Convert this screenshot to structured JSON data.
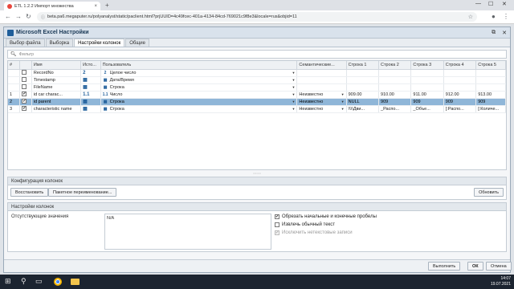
{
  "browser": {
    "tab_title": "ETL 1.2.2 Импорт множества",
    "close_glyph": "×",
    "new_tab": "+",
    "url": "beta.pa6.megaputer.ru/polyanalyst/static/paclient.html?prjUUID=4c49fcec-401a-4134-84cd-769021c9f8e3&locale=rus&objid=11"
  },
  "window": {
    "title": "Microsoft Excel Настройки"
  },
  "tabs": [
    "Выбор файла",
    "Выборка",
    "Настройки колонок",
    "Общие"
  ],
  "active_tab": 2,
  "filter": {
    "placeholder": "Фильтр"
  },
  "grid": {
    "headers": [
      "#",
      "",
      "Имя",
      "Исто...",
      "Пользователь",
      "Семантические...",
      "Строка 1",
      "Строка 2",
      "Строка 3",
      "Строка 4",
      "Строка 5"
    ],
    "rows": [
      {
        "num": "",
        "checked": false,
        "name": "RecordNo",
        "src": "2",
        "type_icon": "2",
        "type": "Целое число",
        "sem": "",
        "s1": "",
        "s2": "",
        "s3": "",
        "s4": "",
        "s5": ""
      },
      {
        "num": "",
        "checked": false,
        "name": "Timestamp",
        "src": "▦",
        "type_icon": "▦",
        "type": "Дата/Время",
        "sem": "",
        "s1": "",
        "s2": "",
        "s3": "",
        "s4": "",
        "s5": ""
      },
      {
        "num": "",
        "checked": false,
        "name": "FileName",
        "src": "▦",
        "type_icon": "▦",
        "type": "Строка",
        "sem": "",
        "s1": "",
        "s2": "",
        "s3": "",
        "s4": "",
        "s5": ""
      },
      {
        "num": "1",
        "checked": true,
        "name": "id car charac...",
        "src": "1.1",
        "type_icon": "1.1",
        "type": "Число",
        "sem": "Неизвестно",
        "s1": "909.00",
        "s2": "910.00",
        "s3": "911.00",
        "s4": "912.00",
        "s5": "913.00"
      },
      {
        "num": "2",
        "checked": true,
        "name": "id parent",
        "src": "▦",
        "type_icon": "▦",
        "type": "Строка",
        "sem": "Неизвестно",
        "s1": "NULL",
        "s2": "909",
        "s3": "909",
        "s4": "909",
        "s5": "909"
      },
      {
        "num": "3",
        "checked": true,
        "name": "characteristic name",
        "src": "▦",
        "type_icon": "▦",
        "type": "Строка",
        "sem": "Неизвестно",
        "s1": "\\\\\\\\Дви...",
        "s2": "_Распо...",
        "s3": "_Объе...",
        "s4": "[:Распо...",
        "s5": "[:Количе..."
      }
    ],
    "selected_row": 4
  },
  "config_panel": {
    "title": "Конфигурация колонок",
    "restore": "Восстановить",
    "batch_rename": "Пакетное переименование...",
    "refresh": "Обновить"
  },
  "column_settings": {
    "title": "Настройки колонок",
    "missing_label": "Отсутствующие значения",
    "missing_value": "N/A",
    "opt_trim": "Обрезать начальные и конечные пробелы",
    "opt_plain": "Извлечь обычный текст",
    "opt_exclude": "Исключить нетекстовые записи"
  },
  "footer": {
    "run": "Выполнить",
    "ok": "ОК",
    "cancel": "Отмена"
  },
  "taskbar": {
    "time": "14:07",
    "date": "19.07.2021"
  },
  "colors": {
    "selection": "#8fb6d8",
    "accent": "#1f5e9a"
  }
}
